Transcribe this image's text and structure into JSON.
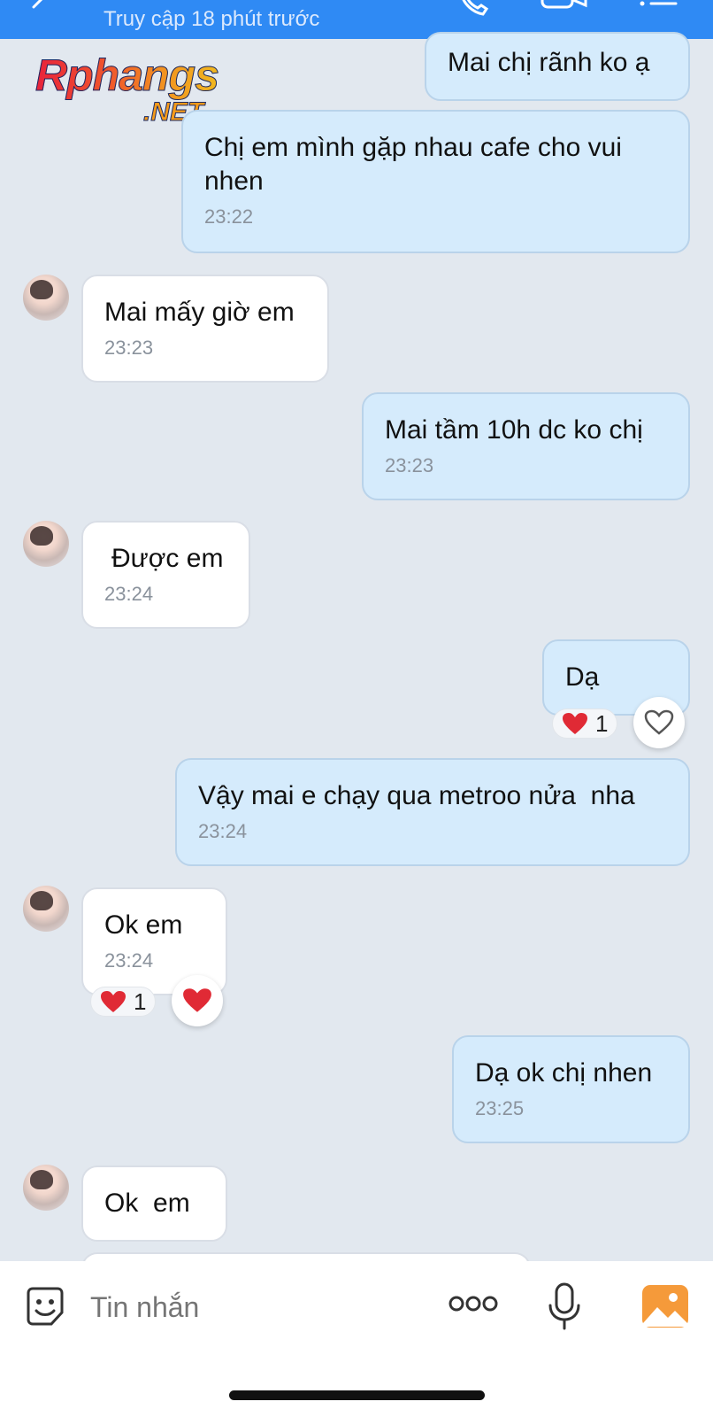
{
  "header": {
    "subtitle": "Truy cập 18 phút trước",
    "icons": [
      "back-arrow-icon",
      "phone-icon",
      "video-call-icon",
      "menu-icon"
    ]
  },
  "watermark": {
    "main": "Rphangs",
    "sub": ".NET"
  },
  "messages": [
    {
      "side": "sent",
      "text": "Mai chị rãnh ko ạ",
      "time": ""
    },
    {
      "side": "sent",
      "text": "Chị em mình gặp nhau cafe cho vui nhen",
      "time": "23:22"
    },
    {
      "side": "received",
      "text": "Mai mấy giờ em",
      "time": "23:23"
    },
    {
      "side": "sent",
      "text": "Mai tầm 10h dc ko chị",
      "time": "23:23"
    },
    {
      "side": "received",
      "text": "Được em",
      "time": "23:24"
    },
    {
      "side": "sent",
      "text": "Dạ",
      "time": "",
      "reaction": {
        "emoji": "heart",
        "count": "1"
      }
    },
    {
      "side": "sent",
      "text": "Vậy mai e chạy qua metroo nửa  nha",
      "time": "23:24"
    },
    {
      "side": "received",
      "text": "Ok em",
      "time": "23:24",
      "reaction": {
        "emoji": "heart",
        "count": "1"
      }
    },
    {
      "side": "sent",
      "text": "Dạ ok chị nhen",
      "time": "23:25"
    },
    {
      "side": "received",
      "text": "Ok  em",
      "time": ""
    }
  ],
  "composer": {
    "placeholder": "Tin nhắn",
    "icons": [
      "sticker-icon",
      "more-icon",
      "microphone-icon",
      "image-icon"
    ]
  },
  "colors": {
    "header": "#2f8af4",
    "background": "#e2e8ef",
    "sent_bubble": "#d5ebfc",
    "received_bubble": "#ffffff",
    "heart": "#e02a35",
    "image_icon": "#f59a3a"
  }
}
